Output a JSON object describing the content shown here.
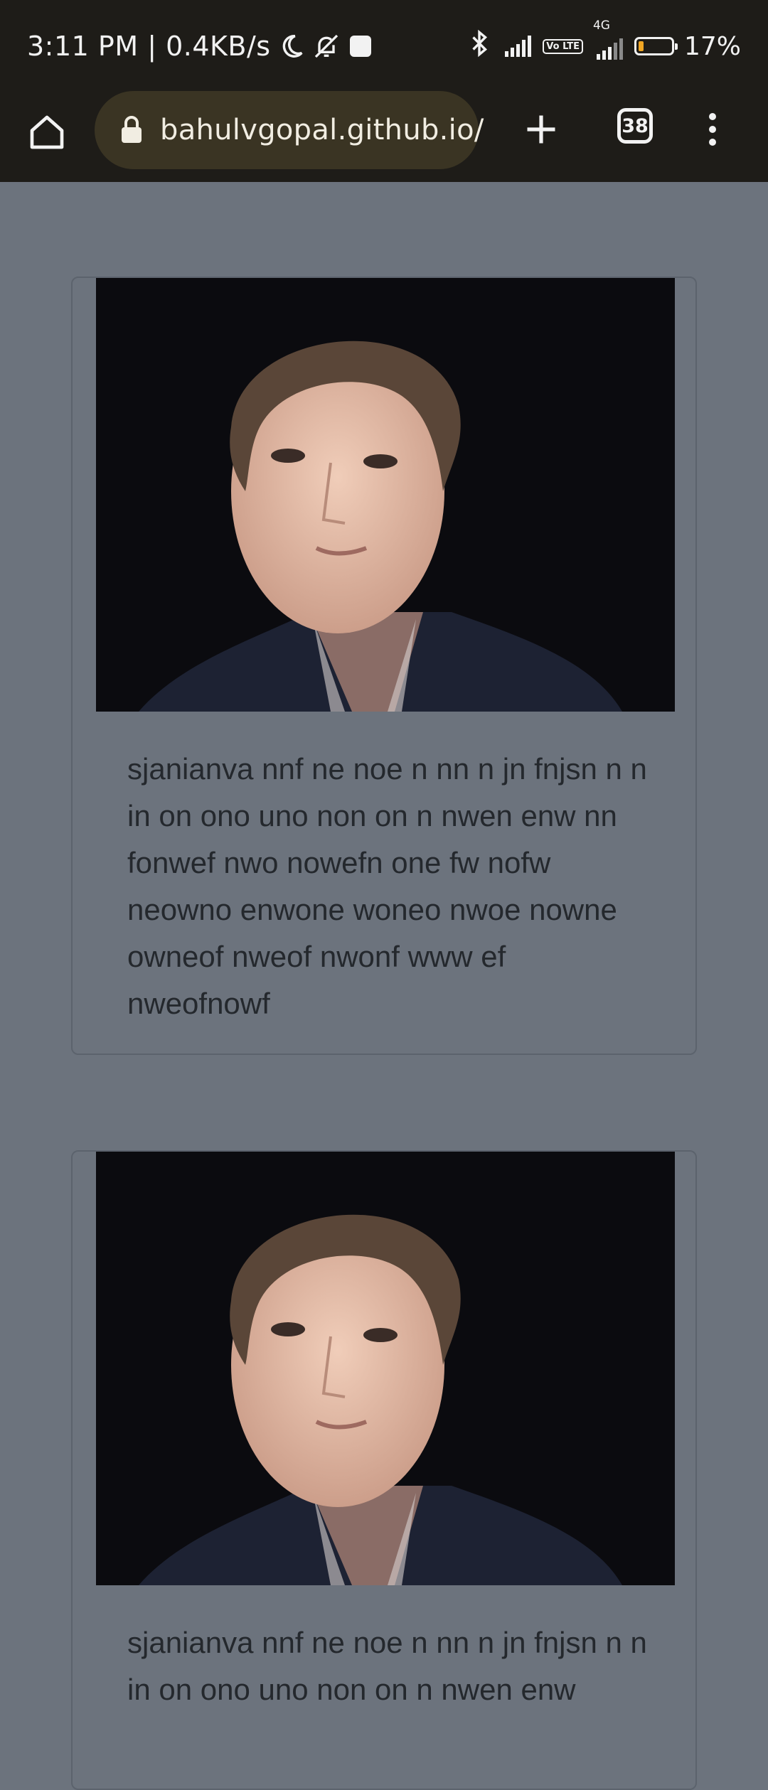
{
  "status_bar": {
    "time_speed": "3:11 PM | 0.4KB/s",
    "network_label": "4G",
    "volte_label": "Vo LTE",
    "battery": "17%",
    "battery_level": 0.17,
    "icons": [
      "moon-icon",
      "bell-off-icon",
      "notification-square-icon",
      "bluetooth-icon",
      "signal-icon",
      "volte-icon",
      "signal-4g-icon",
      "battery-icon"
    ]
  },
  "browser": {
    "url": "bahulvgopal.github.io/",
    "tab_count": "38",
    "icons": [
      "home-icon",
      "lock-icon",
      "new-tab-icon",
      "tabs-icon",
      "menu-icon"
    ]
  },
  "posts": [
    {
      "image_alt": "Portrait photo",
      "text": "sjanianva nnf ne noe n nn n jn fnjsn n n in on ono uno non on n nwen enw nn fonwef nwo nowefn one fw nofw neowno enwone woneo nwoe nowne owneof nweof nwonf www ef nweofnowf"
    },
    {
      "image_alt": "Portrait photo",
      "text": "sjanianva nnf ne noe n nn n jn fnjsn n n in on ono uno non on n nwen enw"
    }
  ],
  "colors": {
    "page_bg": "#6c737d",
    "chrome_bg": "#1e1c18",
    "url_pill": "#3a3423",
    "battery_accent": "#f0a623"
  }
}
